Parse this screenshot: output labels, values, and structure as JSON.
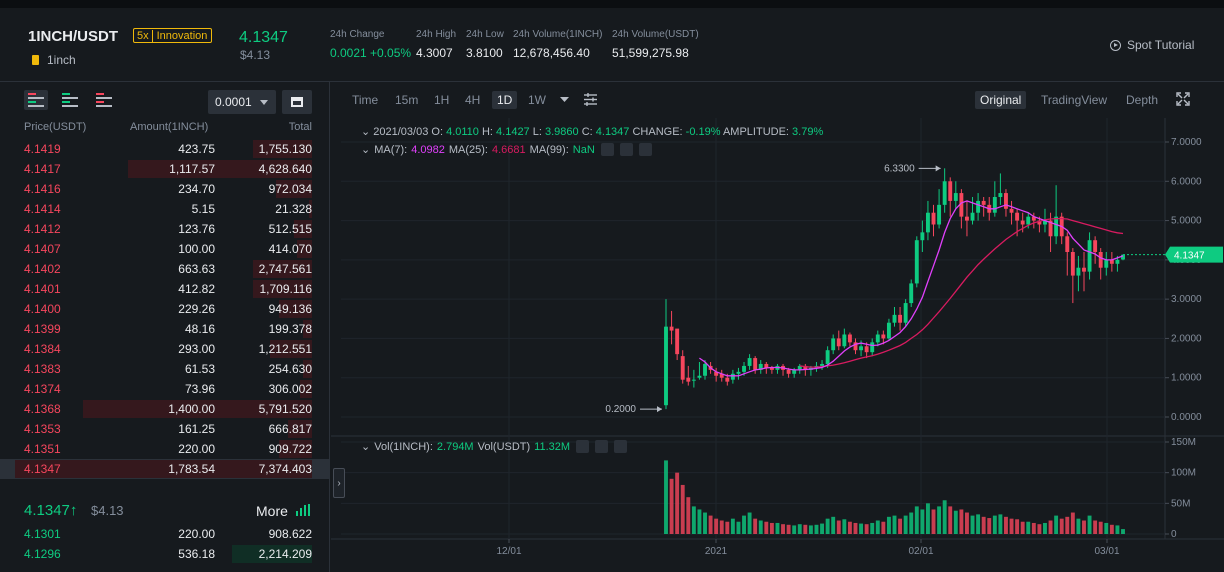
{
  "header": {
    "pair": "1INCH/USDT",
    "leverage": "5x",
    "tag": "Innovation",
    "coin_name": "1inch",
    "last_price": "4.1347",
    "last_price_usd": "$4.13",
    "stats": [
      {
        "label": "24h Change",
        "value": "0.0021 +0.05%"
      },
      {
        "label": "24h High",
        "value": "4.3007"
      },
      {
        "label": "24h Low",
        "value": "3.8100"
      },
      {
        "label": "24h Volume(1INCH)",
        "value": "12,678,456.40"
      },
      {
        "label": "24h Volume(USDT)",
        "value": "51,599,275.98"
      }
    ],
    "spot_tutorial": "Spot Tutorial"
  },
  "orderbook": {
    "tick": "0.0001",
    "col_price": "Price(USDT)",
    "col_amount": "Amount(1INCH)",
    "col_total": "Total",
    "asks": [
      {
        "price": "4.1419",
        "amount": "423.75",
        "total": "1,755.130",
        "depth": 0.2
      },
      {
        "price": "4.1417",
        "amount": "1,117.57",
        "total": "4,628.640",
        "depth": 0.62
      },
      {
        "price": "4.1416",
        "amount": "234.70",
        "total": "972.034",
        "depth": 0.12
      },
      {
        "price": "4.1414",
        "amount": "5.15",
        "total": "21.328",
        "depth": 0.01
      },
      {
        "price": "4.1412",
        "amount": "123.76",
        "total": "512.515",
        "depth": 0.06
      },
      {
        "price": "4.1407",
        "amount": "100.00",
        "total": "414.070",
        "depth": 0.05
      },
      {
        "price": "4.1402",
        "amount": "663.63",
        "total": "2,747.561",
        "depth": 0.2
      },
      {
        "price": "4.1401",
        "amount": "412.82",
        "total": "1,709.116",
        "depth": 0.2
      },
      {
        "price": "4.1400",
        "amount": "229.26",
        "total": "949.136",
        "depth": 0.11
      },
      {
        "price": "4.1399",
        "amount": "48.16",
        "total": "199.378",
        "depth": 0.03
      },
      {
        "price": "4.1384",
        "amount": "293.00",
        "total": "1,212.551",
        "depth": 0.14
      },
      {
        "price": "4.1383",
        "amount": "61.53",
        "total": "254.630",
        "depth": 0.03
      },
      {
        "price": "4.1374",
        "amount": "73.96",
        "total": "306.002",
        "depth": 0.04
      },
      {
        "price": "4.1368",
        "amount": "1,400.00",
        "total": "5,791.520",
        "depth": 0.77
      },
      {
        "price": "4.1353",
        "amount": "161.25",
        "total": "666.817",
        "depth": 0.08
      },
      {
        "price": "4.1351",
        "amount": "220.00",
        "total": "909.722",
        "depth": 0.11
      },
      {
        "price": "4.1347",
        "amount": "1,783.54",
        "total": "7,374.403",
        "depth": 1.0
      }
    ],
    "mid_price": "4.1347",
    "mid_arrow": "↑",
    "mid_usd": "$4.13",
    "more": "More",
    "bids": [
      {
        "price": "4.1301",
        "amount": "220.00",
        "total": "908.622",
        "depth": 0.0
      },
      {
        "price": "4.1296",
        "amount": "536.18",
        "total": "2,214.209",
        "depth": 0.27
      }
    ]
  },
  "chart": {
    "intervals": [
      "Time",
      "15m",
      "1H",
      "4H",
      "1D",
      "1W"
    ],
    "active_interval": "1D",
    "views": [
      "Original",
      "TradingView",
      "Depth"
    ],
    "active_view": "Original",
    "ohlc": {
      "date": "2021/03/03",
      "o": "4.0110",
      "h": "4.1427",
      "l": "3.9860",
      "c": "4.1347",
      "change": "-0.19%",
      "amplitude": "3.79%"
    },
    "ma": {
      "ma7_label": "MA(7):",
      "ma7": "4.0982",
      "ma25_label": "MA(25):",
      "ma25": "4.6681",
      "ma99_label": "MA(99):",
      "ma99": "NaN"
    },
    "vol": {
      "l1": "Vol(1INCH):",
      "v1": "2.794M",
      "l2": "Vol(USDT)",
      "v2": "11.32M"
    },
    "colors": {
      "up": "#0ecb81",
      "down": "#f6465d",
      "ma7": "#e040fb",
      "ma25": "#d81b60"
    }
  },
  "chart_data": {
    "type": "candlestick",
    "y_ticks": [
      "7.0000",
      "6.0000",
      "5.0000",
      "4.0000",
      "3.0000",
      "2.0000",
      "1.0000",
      "0.0000"
    ],
    "vol_ticks": [
      "150M",
      "100M",
      "50M",
      "0"
    ],
    "x_ticks": [
      "12/01",
      "2021",
      "02/01",
      "03/01"
    ],
    "ylim": [
      0,
      7
    ],
    "vol_lim": [
      0,
      150
    ],
    "current_price": "4.1347",
    "annotations": {
      "high_label": "6.3300",
      "low_label": "0.2000"
    },
    "candles": [
      [
        0.3,
        2.3,
        0.2,
        3.0,
        120
      ],
      [
        2.3,
        2.2,
        1.85,
        2.7,
        90
      ],
      [
        2.25,
        1.6,
        1.45,
        2.2,
        100
      ],
      [
        1.55,
        0.95,
        0.85,
        1.7,
        80
      ],
      [
        1.0,
        0.9,
        0.8,
        1.3,
        60
      ],
      [
        0.95,
        0.95,
        0.75,
        1.2,
        45
      ],
      [
        1.0,
        1.05,
        0.95,
        1.4,
        40
      ],
      [
        1.05,
        1.35,
        0.95,
        1.45,
        35
      ],
      [
        1.3,
        1.2,
        1.1,
        1.4,
        30
      ],
      [
        1.15,
        1.05,
        0.9,
        1.25,
        25
      ],
      [
        1.1,
        1.0,
        0.9,
        1.2,
        22
      ],
      [
        1.0,
        0.9,
        0.8,
        1.1,
        20
      ],
      [
        0.95,
        1.1,
        0.85,
        1.2,
        25
      ],
      [
        1.1,
        1.15,
        0.95,
        1.25,
        20
      ],
      [
        1.15,
        1.3,
        1.05,
        1.4,
        30
      ],
      [
        1.3,
        1.5,
        1.2,
        1.6,
        35
      ],
      [
        1.5,
        1.2,
        1.1,
        1.55,
        25
      ],
      [
        1.2,
        1.35,
        1.1,
        1.45,
        22
      ],
      [
        1.35,
        1.25,
        1.1,
        1.4,
        20
      ],
      [
        1.25,
        1.2,
        1.1,
        1.3,
        18
      ],
      [
        1.2,
        1.3,
        1.1,
        1.35,
        18
      ],
      [
        1.3,
        1.2,
        1.05,
        1.35,
        16
      ],
      [
        1.2,
        1.1,
        1.0,
        1.25,
        15
      ],
      [
        1.1,
        1.2,
        1.0,
        1.25,
        14
      ],
      [
        1.2,
        1.3,
        1.1,
        1.35,
        16
      ],
      [
        1.3,
        1.2,
        1.05,
        1.35,
        15
      ],
      [
        1.2,
        1.25,
        1.05,
        1.3,
        14
      ],
      [
        1.25,
        1.3,
        1.15,
        1.4,
        15
      ],
      [
        1.3,
        1.35,
        1.2,
        1.45,
        17
      ],
      [
        1.35,
        1.7,
        1.25,
        1.8,
        25
      ],
      [
        1.7,
        2.0,
        1.6,
        2.1,
        28
      ],
      [
        2.0,
        1.8,
        1.7,
        2.2,
        22
      ],
      [
        1.8,
        2.1,
        1.75,
        2.25,
        24
      ],
      [
        2.1,
        1.9,
        1.8,
        2.15,
        20
      ],
      [
        1.9,
        1.7,
        1.6,
        2.0,
        18
      ],
      [
        1.7,
        1.8,
        1.55,
        1.95,
        17
      ],
      [
        1.8,
        1.65,
        1.5,
        1.9,
        16
      ],
      [
        1.65,
        1.9,
        1.55,
        2.0,
        18
      ],
      [
        1.9,
        2.1,
        1.8,
        2.2,
        22
      ],
      [
        2.1,
        2.0,
        1.85,
        2.2,
        20
      ],
      [
        2.0,
        2.4,
        1.95,
        2.5,
        28
      ],
      [
        2.4,
        2.6,
        2.3,
        2.8,
        30
      ],
      [
        2.6,
        2.4,
        2.2,
        2.8,
        25
      ],
      [
        2.4,
        2.9,
        2.3,
        3.0,
        30
      ],
      [
        2.9,
        3.4,
        2.8,
        3.5,
        35
      ],
      [
        3.4,
        4.5,
        3.3,
        4.6,
        45
      ],
      [
        4.5,
        4.7,
        4.2,
        5.0,
        40
      ],
      [
        4.7,
        5.2,
        4.5,
        5.5,
        50
      ],
      [
        5.2,
        4.9,
        4.6,
        5.4,
        40
      ],
      [
        4.9,
        5.4,
        4.8,
        5.8,
        45
      ],
      [
        5.4,
        6.0,
        5.2,
        6.33,
        55
      ],
      [
        6.0,
        5.5,
        5.1,
        6.1,
        45
      ],
      [
        5.5,
        5.7,
        5.3,
        6.0,
        38
      ],
      [
        5.7,
        5.1,
        4.8,
        5.8,
        40
      ],
      [
        5.1,
        5.0,
        4.6,
        5.5,
        35
      ],
      [
        5.0,
        5.2,
        4.9,
        5.6,
        30
      ],
      [
        5.2,
        5.5,
        5.0,
        5.7,
        32
      ],
      [
        5.5,
        5.4,
        5.1,
        5.6,
        28
      ],
      [
        5.4,
        5.2,
        5.0,
        5.6,
        26
      ],
      [
        5.2,
        5.6,
        5.1,
        6.0,
        30
      ],
      [
        5.6,
        5.7,
        5.4,
        6.2,
        32
      ],
      [
        5.7,
        5.3,
        5.1,
        5.8,
        28
      ],
      [
        5.3,
        5.2,
        4.9,
        5.5,
        25
      ],
      [
        5.2,
        5.0,
        4.6,
        5.3,
        24
      ],
      [
        5.0,
        4.9,
        4.7,
        5.2,
        20
      ],
      [
        4.9,
        5.1,
        4.8,
        5.2,
        20
      ],
      [
        5.1,
        5.0,
        4.8,
        5.2,
        18
      ],
      [
        5.0,
        4.9,
        4.7,
        5.1,
        16
      ],
      [
        4.9,
        5.0,
        4.7,
        5.3,
        18
      ],
      [
        5.0,
        4.6,
        4.2,
        5.2,
        22
      ],
      [
        4.6,
        5.1,
        4.4,
        5.9,
        30
      ],
      [
        5.1,
        4.6,
        4.4,
        5.2,
        25
      ],
      [
        4.6,
        4.2,
        3.6,
        4.7,
        28
      ],
      [
        4.2,
        3.6,
        2.9,
        4.3,
        35
      ],
      [
        3.6,
        3.8,
        3.2,
        4.1,
        25
      ],
      [
        3.8,
        3.7,
        3.2,
        4.2,
        22
      ],
      [
        3.7,
        4.5,
        3.5,
        4.7,
        30
      ],
      [
        4.5,
        4.2,
        3.9,
        4.6,
        22
      ],
      [
        4.2,
        3.8,
        3.5,
        4.3,
        20
      ],
      [
        3.8,
        4.0,
        3.6,
        4.2,
        18
      ],
      [
        4.0,
        3.9,
        3.7,
        4.2,
        15
      ],
      [
        3.9,
        4.0,
        3.7,
        4.1,
        14
      ],
      [
        4.01,
        4.13,
        3.99,
        4.14,
        8
      ]
    ],
    "ma7": [
      null,
      null,
      null,
      null,
      null,
      null,
      1.5,
      1.4,
      1.25,
      1.15,
      1.1,
      1.05,
      1.05,
      1.05,
      1.1,
      1.15,
      1.2,
      1.22,
      1.25,
      1.26,
      1.26,
      1.25,
      1.22,
      1.2,
      1.2,
      1.21,
      1.22,
      1.24,
      1.26,
      1.32,
      1.42,
      1.55,
      1.68,
      1.78,
      1.85,
      1.88,
      1.85,
      1.82,
      1.83,
      1.88,
      1.95,
      2.05,
      2.15,
      2.3,
      2.5,
      2.75,
      3.05,
      3.45,
      3.85,
      4.25,
      4.7,
      5.05,
      5.3,
      5.45,
      5.5,
      5.45,
      5.4,
      5.35,
      5.3,
      5.3,
      5.35,
      5.4,
      5.35,
      5.3,
      5.25,
      5.2,
      5.1,
      5.05,
      5.0,
      4.95,
      4.9,
      4.85,
      4.75,
      4.55,
      4.4,
      4.25,
      4.2,
      4.15,
      4.05,
      4.0,
      4.0,
      4.05,
      4.1
    ],
    "ma25": [
      null,
      null,
      null,
      null,
      null,
      null,
      null,
      null,
      null,
      null,
      null,
      null,
      null,
      null,
      null,
      null,
      null,
      null,
      null,
      null,
      null,
      null,
      null,
      null,
      1.3,
      1.28,
      1.27,
      1.27,
      1.28,
      1.3,
      1.32,
      1.35,
      1.38,
      1.42,
      1.46,
      1.5,
      1.53,
      1.56,
      1.6,
      1.65,
      1.7,
      1.76,
      1.82,
      1.9,
      2.0,
      2.1,
      2.22,
      2.36,
      2.52,
      2.68,
      2.85,
      3.02,
      3.2,
      3.38,
      3.56,
      3.72,
      3.88,
      4.02,
      4.15,
      4.28,
      4.4,
      4.52,
      4.62,
      4.72,
      4.8,
      4.88,
      4.94,
      4.98,
      5.02,
      5.04,
      5.05,
      5.05,
      5.04,
      5.0,
      4.96,
      4.92,
      4.88,
      4.84,
      4.8,
      4.76,
      4.72,
      4.69,
      4.67
    ]
  }
}
